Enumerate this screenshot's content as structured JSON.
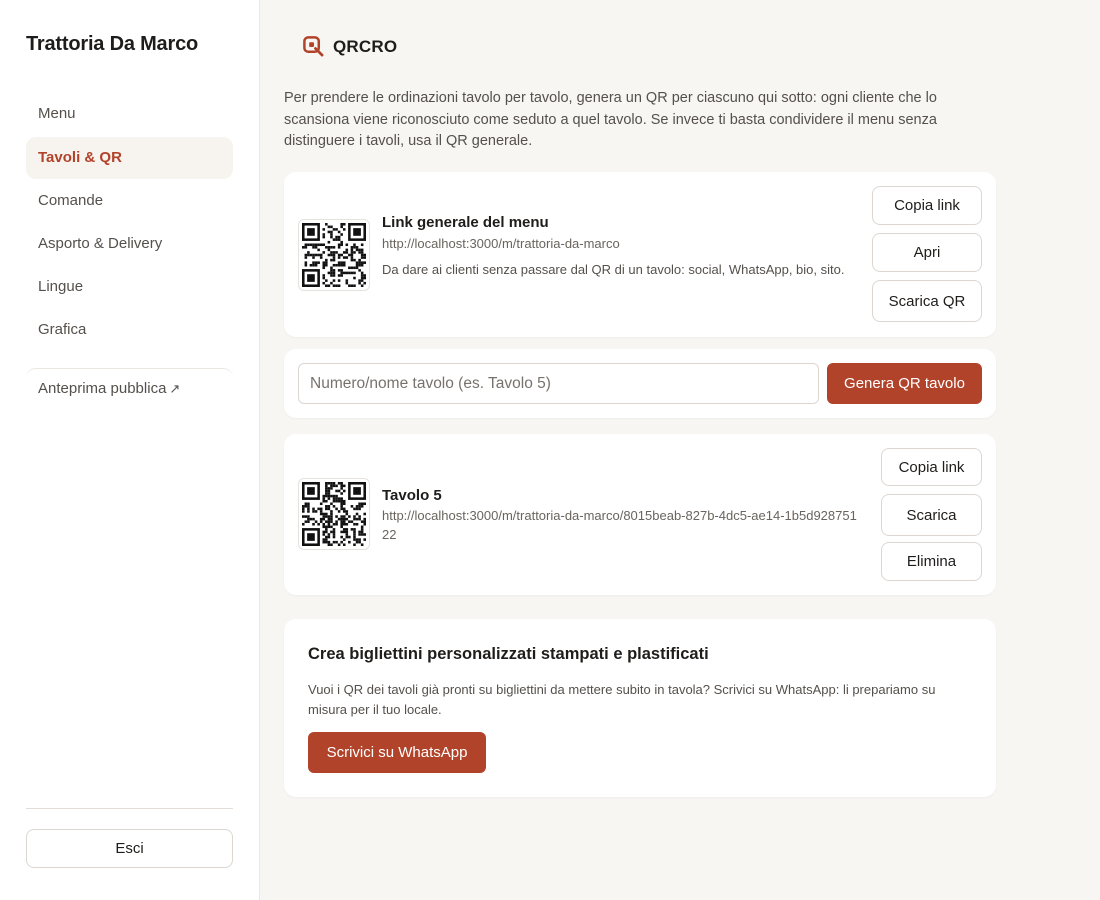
{
  "sidebar": {
    "restaurant_name": "Trattoria Da Marco",
    "items": [
      {
        "label": "Menu"
      },
      {
        "label": "Tavoli & QR",
        "active": true
      },
      {
        "label": "Comande"
      },
      {
        "label": "Asporto & Delivery"
      },
      {
        "label": "Lingue"
      },
      {
        "label": "Grafica"
      }
    ],
    "public_preview": {
      "label": "Anteprima pubblica",
      "icon": "external-link-icon",
      "glyph": "↗"
    },
    "logout_label": "Esci"
  },
  "brand": {
    "name": "QRCRO",
    "logo_icon": "qrcro-logo-icon",
    "accent": "#b2432b"
  },
  "main": {
    "intro": "Per prendere le ordinazioni tavolo per tavolo, genera un QR per ciascuno qui sotto: ogni cliente che lo scansiona viene riconosciuto come seduto a quel tavolo. Se invece ti basta condividere il menu senza distinguere i tavoli, usa il QR generale.",
    "general": {
      "title": "Link generale del menu",
      "url": "http://localhost:3000/m/trattoria-da-marco",
      "description": "Da dare ai clienti senza passare dal QR di un tavolo: social, WhatsApp, bio, sito.",
      "buttons": {
        "copy": "Copia link",
        "open": "Apri",
        "download": "Scarica QR"
      }
    },
    "create": {
      "placeholder": "Numero/nome tavolo (es. Tavolo 5)",
      "button": "Genera QR tavolo"
    },
    "tables": [
      {
        "name": "Tavolo 5",
        "url": "http://localhost:3000/m/trattoria-da-marco/8015beab-827b-4dc5-ae14-1b5d92875122",
        "buttons": {
          "copy": "Copia link",
          "download": "Scarica",
          "delete": "Elimina"
        }
      }
    ],
    "promo": {
      "title": "Crea bigliettini personalizzati stampati e plastificati",
      "text": "Vuoi i QR dei tavoli già pronti su bigliettini da mettere subito in tavola? Scrivici su WhatsApp: li prepariamo su misura per il tuo locale.",
      "button": "Scrivici su WhatsApp"
    }
  },
  "colors": {
    "accent": "#b2432b",
    "background": "#f8f6f3",
    "active_nav_bg": "#f7f3ee"
  }
}
